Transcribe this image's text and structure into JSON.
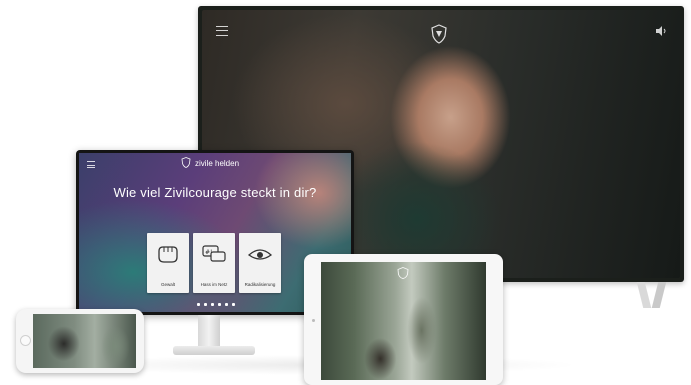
{
  "monitor": {
    "logo_text": "zivile helden",
    "headline": "Wie viel Zivilcourage steckt in dir?",
    "subtitle": "",
    "cards": [
      {
        "label": "Gewalt",
        "icon": "fist-icon"
      },
      {
        "label": "Hass im Netz",
        "icon": "chat-bubbles-icon"
      },
      {
        "label": "Radikalisierung",
        "icon": "eye-icon"
      }
    ]
  },
  "tv": {
    "menu_icon": "hamburger-icon",
    "sound_icon": "speaker-icon",
    "logo_icon": "shield-logo-icon"
  },
  "tablet": {
    "logo_icon": "shield-logo-icon"
  },
  "phone": {}
}
